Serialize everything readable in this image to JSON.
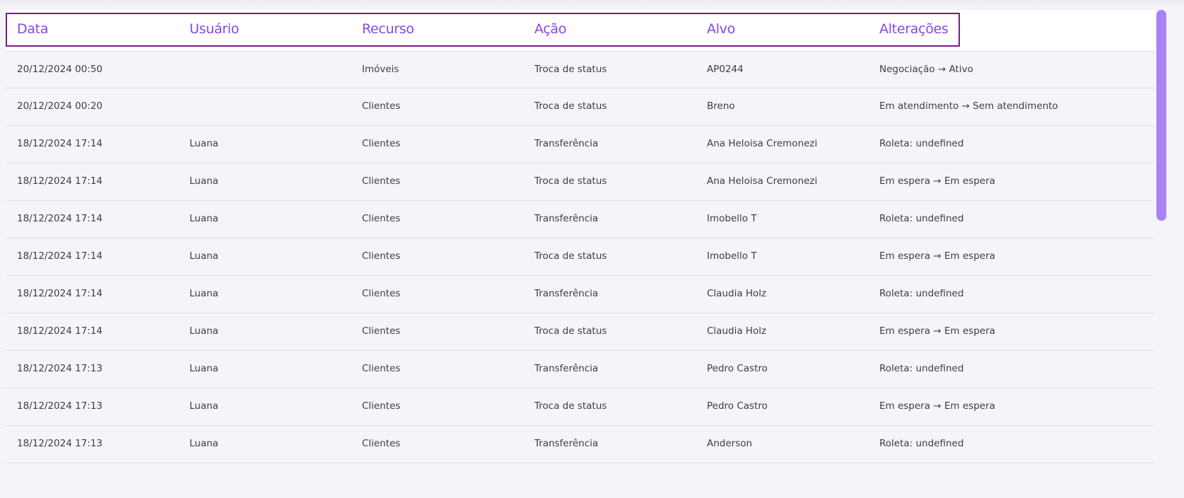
{
  "table": {
    "columns": [
      "Data",
      "Usuário",
      "Recurso",
      "Ação",
      "Alvo",
      "Alterações"
    ],
    "rows": [
      [
        "20/12/2024 00:50",
        "",
        "Imóveis",
        "Troca de status",
        "AP0244",
        "Negociação → Ativo"
      ],
      [
        "20/12/2024 00:20",
        "",
        "Clientes",
        "Troca de status",
        "Breno",
        "Em atendimento → Sem atendimento"
      ],
      [
        "18/12/2024 17:14",
        "Luana",
        "Clientes",
        "Transferência",
        "Ana Heloisa Cremonezi",
        "Roleta: undefined"
      ],
      [
        "18/12/2024 17:14",
        "Luana",
        "Clientes",
        "Troca de status",
        "Ana Heloisa Cremonezi",
        "Em espera → Em espera"
      ],
      [
        "18/12/2024 17:14",
        "Luana",
        "Clientes",
        "Transferência",
        "Imobello T",
        "Roleta: undefined"
      ],
      [
        "18/12/2024 17:14",
        "Luana",
        "Clientes",
        "Troca de status",
        "Imobello T",
        "Em espera → Em espera"
      ],
      [
        "18/12/2024 17:14",
        "Luana",
        "Clientes",
        "Transferência",
        "Claudia Holz",
        "Roleta: undefined"
      ],
      [
        "18/12/2024 17:14",
        "Luana",
        "Clientes",
        "Troca de status",
        "Claudia Holz",
        "Em espera → Em espera"
      ],
      [
        "18/12/2024 17:13",
        "Luana",
        "Clientes",
        "Transferência",
        "Pedro Castro",
        "Roleta: undefined"
      ],
      [
        "18/12/2024 17:13",
        "Luana",
        "Clientes",
        "Troca de status",
        "Pedro Castro",
        "Em espera → Em espera"
      ],
      [
        "18/12/2024 17:13",
        "Luana",
        "Clientes",
        "Transferência",
        "Anderson",
        "Roleta: undefined"
      ]
    ]
  },
  "colors": {
    "header_text": "#8b45e3",
    "header_highlight_border": "#7a1a86",
    "scrollbar": "#a982f3",
    "background": "#f4f4f9"
  }
}
